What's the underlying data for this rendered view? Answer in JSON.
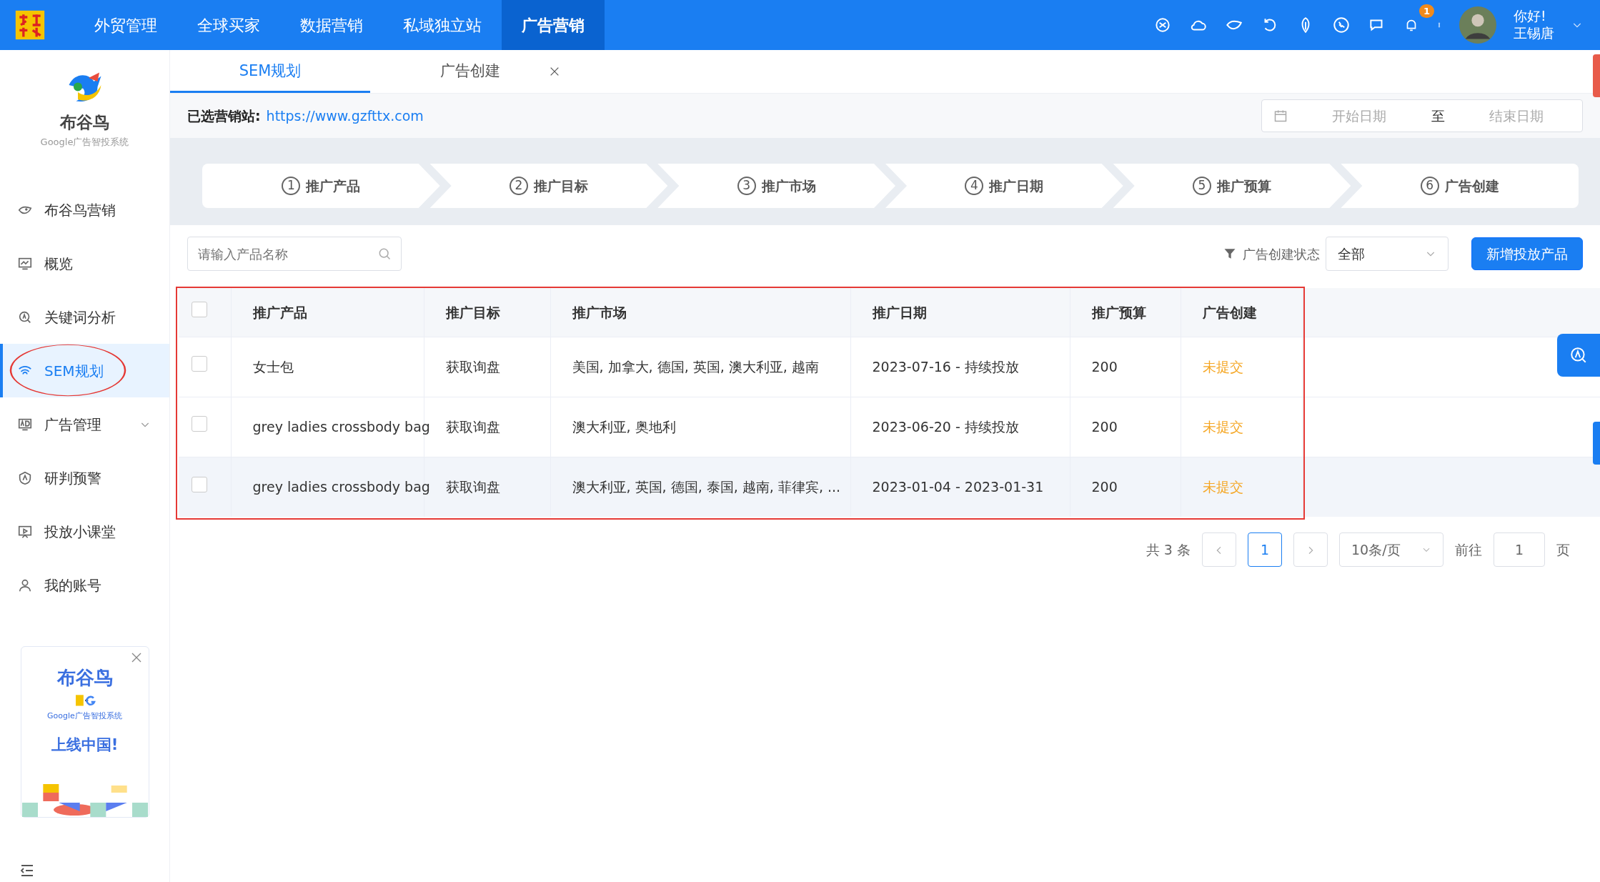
{
  "topnav": {
    "items": [
      {
        "label": "外贸管理",
        "selected": false
      },
      {
        "label": "全球买家",
        "selected": false
      },
      {
        "label": "数据营销",
        "selected": false
      },
      {
        "label": "私域独立站",
        "selected": false
      },
      {
        "label": "广告营销",
        "selected": true
      }
    ],
    "notifications": "1",
    "greeting": "你好!",
    "user": "王锡唐"
  },
  "sidebar": {
    "brand": "布谷鸟",
    "brand_sub": "Google广告智投系统",
    "items": [
      {
        "label": "布谷鸟营销",
        "kind": "bird",
        "selected": false,
        "expandable": false
      },
      {
        "label": "概览",
        "kind": "monitor",
        "selected": false,
        "expandable": false
      },
      {
        "label": "关键词分析",
        "kind": "search",
        "selected": false,
        "expandable": false
      },
      {
        "label": "SEM规划",
        "kind": "wifi",
        "selected": true,
        "expandable": false
      },
      {
        "label": "广告管理",
        "kind": "ad",
        "selected": false,
        "expandable": true
      },
      {
        "label": "研判预警",
        "kind": "shield",
        "selected": false,
        "expandable": false
      },
      {
        "label": "投放小课堂",
        "kind": "play",
        "selected": false,
        "expandable": false
      },
      {
        "label": "我的账号",
        "kind": "user",
        "selected": false,
        "expandable": false
      }
    ],
    "promo": {
      "title": "布谷鸟",
      "subtitle": "Google广告智投系统",
      "slogan": "上线中国!"
    }
  },
  "tabs": [
    {
      "label": "SEM规划",
      "selected": true,
      "closable": false
    },
    {
      "label": "广告创建",
      "selected": false,
      "closable": true
    }
  ],
  "site": {
    "label": "已选营销站:",
    "url": "https://www.gzfttx.com"
  },
  "date_range": {
    "start_placeholder": "开始日期",
    "separator": "至",
    "end_placeholder": "结束日期"
  },
  "steps": [
    {
      "number": "1",
      "label": "推广产品"
    },
    {
      "number": "2",
      "label": "推广目标"
    },
    {
      "number": "3",
      "label": "推广市场"
    },
    {
      "number": "4",
      "label": "推广日期"
    },
    {
      "number": "5",
      "label": "推广预算"
    },
    {
      "number": "6",
      "label": "广告创建"
    }
  ],
  "search": {
    "placeholder": "请输入产品名称"
  },
  "filter": {
    "label": "广告创建状态",
    "value": "全部"
  },
  "add_button": "新增投放产品",
  "table": {
    "all_checked": false,
    "columns": [
      "推广产品",
      "推广目标",
      "推广市场",
      "推广日期",
      "推广预算",
      "广告创建"
    ],
    "rows": [
      {
        "checked": false,
        "highlighted": false,
        "cells": [
          "女士包",
          "获取询盘",
          "美国, 加拿大, 德国, 英国, 澳大利亚, 越南",
          "2023-07-16 - 持续投放",
          "200",
          "未提交"
        ]
      },
      {
        "checked": false,
        "highlighted": false,
        "cells": [
          "grey ladies crossbody bag",
          "获取询盘",
          "澳大利亚, 奥地利",
          "2023-06-20 - 持续投放",
          "200",
          "未提交"
        ]
      },
      {
        "checked": false,
        "highlighted": true,
        "cells": [
          "grey ladies crossbody bag",
          "获取询盘",
          "澳大利亚, 英国, 德国, 泰国, 越南, 菲律宾, ...",
          "2023-01-04 - 2023-01-31",
          "200",
          "未提交"
        ]
      }
    ]
  },
  "pagination": {
    "total": "共 3 条",
    "pages": [
      {
        "label": "1",
        "selected": true
      }
    ],
    "page_size": "10条/页",
    "goto_label": "前往",
    "goto_value": "1",
    "page_suffix": "页"
  }
}
